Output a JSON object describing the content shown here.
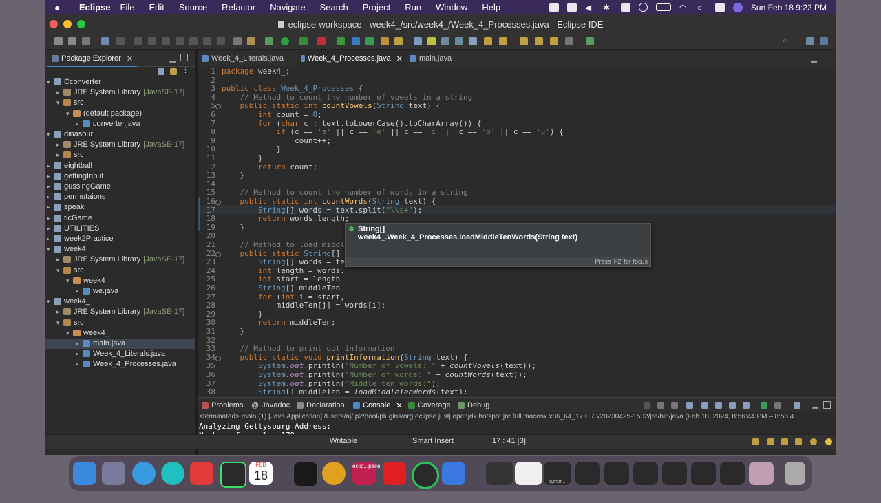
{
  "menubar": {
    "app": "Eclipse",
    "items": [
      "File",
      "Edit",
      "Source",
      "Refactor",
      "Navigate",
      "Search",
      "Project",
      "Run",
      "Window",
      "Help"
    ],
    "clock": "Sun Feb 18  9:22 PM"
  },
  "window": {
    "title": "eclipse-workspace - week4_/src/week4_/Week_4_Processes.java - Eclipse IDE"
  },
  "package_explorer": {
    "title": "Package Explorer",
    "tree": [
      {
        "label": "Cconverter",
        "suffix": "",
        "icon": "project-icon",
        "depth": 0,
        "twisty": "v"
      },
      {
        "label": "JRE System Library",
        "suffix": "[JavaSE-17]",
        "icon": "library-icon",
        "depth": 1,
        "twisty": ">"
      },
      {
        "label": "src",
        "suffix": "",
        "icon": "folder-icon",
        "depth": 1,
        "twisty": "v"
      },
      {
        "label": "(default package)",
        "suffix": "",
        "icon": "package-icon",
        "depth": 2,
        "twisty": "v"
      },
      {
        "label": "converter.java",
        "suffix": "",
        "icon": "java-file-icon",
        "depth": 3,
        "twisty": ">"
      },
      {
        "label": "dinasour",
        "suffix": "",
        "icon": "project-icon",
        "depth": 0,
        "twisty": "v"
      },
      {
        "label": "JRE System Library",
        "suffix": "[JavaSE-17]",
        "icon": "library-icon",
        "depth": 1,
        "twisty": ">"
      },
      {
        "label": "src",
        "suffix": "",
        "icon": "folder-icon",
        "depth": 1,
        "twisty": ">"
      },
      {
        "label": "eightball",
        "suffix": "",
        "icon": "project-icon",
        "depth": 0,
        "twisty": ">"
      },
      {
        "label": "gettingInput",
        "suffix": "",
        "icon": "project-icon",
        "depth": 0,
        "twisty": ">"
      },
      {
        "label": "gussingGame",
        "suffix": "",
        "icon": "project-icon",
        "depth": 0,
        "twisty": ">"
      },
      {
        "label": "permutaions",
        "suffix": "",
        "icon": "project-icon",
        "depth": 0,
        "twisty": ">"
      },
      {
        "label": "speak",
        "suffix": "",
        "icon": "project-icon",
        "depth": 0,
        "twisty": ">"
      },
      {
        "label": "ticGame",
        "suffix": "",
        "icon": "project-icon",
        "depth": 0,
        "twisty": ">"
      },
      {
        "label": "UTILITIES",
        "suffix": "",
        "icon": "project-icon",
        "depth": 0,
        "twisty": ">"
      },
      {
        "label": "week2Practice",
        "suffix": "",
        "icon": "project-icon",
        "depth": 0,
        "twisty": ">"
      },
      {
        "label": "week4",
        "suffix": "",
        "icon": "project-icon",
        "depth": 0,
        "twisty": "v"
      },
      {
        "label": "JRE System Library",
        "suffix": "[JavaSE-17]",
        "icon": "library-icon",
        "depth": 1,
        "twisty": ">"
      },
      {
        "label": "src",
        "suffix": "",
        "icon": "folder-icon",
        "depth": 1,
        "twisty": "v"
      },
      {
        "label": "week4",
        "suffix": "",
        "icon": "package-icon",
        "depth": 2,
        "twisty": "v"
      },
      {
        "label": "we.java",
        "suffix": "",
        "icon": "java-file-icon",
        "depth": 3,
        "twisty": ">"
      },
      {
        "label": "week4_",
        "suffix": "",
        "icon": "project-icon",
        "depth": 0,
        "twisty": "v"
      },
      {
        "label": "JRE System Library",
        "suffix": "[JavaSE-17]",
        "icon": "library-icon",
        "depth": 1,
        "twisty": ">"
      },
      {
        "label": "src",
        "suffix": "",
        "icon": "folder-icon",
        "depth": 1,
        "twisty": "v"
      },
      {
        "label": "week4_",
        "suffix": "",
        "icon": "package-icon",
        "depth": 2,
        "twisty": "v"
      },
      {
        "label": "main.java",
        "suffix": "",
        "icon": "java-file-icon",
        "depth": 3,
        "twisty": ">",
        "selected": true
      },
      {
        "label": "Week_4_Literals.java",
        "suffix": "",
        "icon": "java-file-icon",
        "depth": 3,
        "twisty": ">"
      },
      {
        "label": "Week_4_Processes.java",
        "suffix": "",
        "icon": "java-file-icon",
        "depth": 3,
        "twisty": ">"
      }
    ]
  },
  "editor": {
    "tabs": [
      {
        "label": "Week_4_Literals.java",
        "active": false
      },
      {
        "label": "Week_4_Processes.java",
        "active": true
      },
      {
        "label": "main.java",
        "active": false
      }
    ],
    "lines": [
      {
        "n": "1",
        "code": "<span class=\"kw\">package</span> week4_;"
      },
      {
        "n": "2",
        "code": ""
      },
      {
        "n": "3",
        "code": "<span class=\"kw\">public class</span> <span class=\"ty\">Week_4_Processes</span> {"
      },
      {
        "n": "4",
        "code": "    <span class=\"cm\">// Method to count the number of vowels in a string</span>"
      },
      {
        "n": "5",
        "code": "    <span class=\"kw\">public static int</span> <span class=\"mt\">countVowels</span>(<span class=\"ty\">String</span> text) {"
      },
      {
        "n": "6",
        "code": "        <span class=\"kw\">int</span> count = <span class=\"ty\">0</span>;"
      },
      {
        "n": "7",
        "code": "        <span class=\"kw\">for</span> (<span class=\"kw\">char</span> c : text.toLowerCase().toCharArray()) {"
      },
      {
        "n": "8",
        "code": "            <span class=\"kw\">if</span> (c == <span class=\"st\">'a'</span> || c == <span class=\"st\">'e'</span> || c == <span class=\"st\">'i'</span> || c == <span class=\"st\">'o'</span> || c == <span class=\"st\">'u'</span>) {"
      },
      {
        "n": "9",
        "code": "                count++;"
      },
      {
        "n": "10",
        "code": "            }"
      },
      {
        "n": "11",
        "code": "        }"
      },
      {
        "n": "12",
        "code": "        <span class=\"kw\">return</span> count;"
      },
      {
        "n": "13",
        "code": "    }"
      },
      {
        "n": "14",
        "code": ""
      },
      {
        "n": "15",
        "code": "    <span class=\"cm\">// Method to count the number of words in a string</span>"
      },
      {
        "n": "16",
        "code": "    <span class=\"kw\">public static int</span> <span class=\"mt\">countWords</span>(<span class=\"ty\">String</span> text) {"
      },
      {
        "n": "17",
        "code": "        <span class=\"ty\">String</span>[] words = text.split(<span class=\"st\">\"\\\\s+\"</span>);"
      },
      {
        "n": "18",
        "code": "        <span class=\"kw\">return</span> words.length;"
      },
      {
        "n": "19",
        "code": "    }"
      },
      {
        "n": "20",
        "code": ""
      },
      {
        "n": "21",
        "code": "    <span class=\"cm\">// Method to load middle ten words into an array</span>"
      },
      {
        "n": "22",
        "code": "    <span class=\"kw\">public static</span> <span class=\"ty\">String</span>[] <span class=\"mt\">loadMiddleTenWords</span>(<span class=\"ty\">String</span> text) {"
      },
      {
        "n": "23",
        "code": "        <span class=\"ty\">String</span>[] words = te"
      },
      {
        "n": "24",
        "code": "        <span class=\"kw\">int</span> length = words."
      },
      {
        "n": "25",
        "code": "        <span class=\"kw\">int</span> start = length"
      },
      {
        "n": "26",
        "code": "        <span class=\"ty\">String</span>[] middleTen"
      },
      {
        "n": "27",
        "code": "        <span class=\"kw\">for</span> (<span class=\"kw\">int</span> i = start,"
      },
      {
        "n": "28",
        "code": "            middleTen[j] = words[i];"
      },
      {
        "n": "29",
        "code": "        }"
      },
      {
        "n": "30",
        "code": "        <span class=\"kw\">return</span> middleTen;"
      },
      {
        "n": "31",
        "code": "    }"
      },
      {
        "n": "32",
        "code": ""
      },
      {
        "n": "33",
        "code": "    <span class=\"cm\">// Method to print out information</span>"
      },
      {
        "n": "34",
        "code": "    <span class=\"kw\">public static void</span> <span class=\"mt\">printInformation</span>(<span class=\"ty\">String</span> text) {"
      },
      {
        "n": "35",
        "code": "        <span class=\"ty\">System</span>.<span class=\"fd\"><b><i>out</i></b></span>.println(<span class=\"st\">\"Number of vowels: \"</span> + <i>countVowels</i>(text));"
      },
      {
        "n": "36",
        "code": "        <span class=\"ty\">System</span>.<span class=\"fd\"><b><i>out</i></b></span>.println(<span class=\"st\">\"Number of words: \"</span> + <i>countWords</i>(text));"
      },
      {
        "n": "37",
        "code": "        <span class=\"ty\">System</span>.<span class=\"fd\"><b><i>out</i></b></span>.println(<span class=\"st\">\"Middle ten words:\"</span>);"
      },
      {
        "n": "38",
        "code": "        <span class=\"ty\">String</span>[] middleTen = <i>loadMiddleTenWords</i>(text);"
      }
    ],
    "tooltip": {
      "line1": "String[]",
      "line2": "week4_.Week_4_Processes.loadMiddleTenWords(String text)",
      "footer": "Press 'F2' for focus"
    }
  },
  "bottom_panel": {
    "tabs": [
      "Problems",
      "Javadoc",
      "Declaration",
      "Console",
      "Coverage",
      "Debug"
    ],
    "active_tab": "Console",
    "terminated": "<terminated> main (1) [Java Application] /Users/aj/.p2/pool/plugins/org.eclipse.justj.openjdk.hotspot.jre.full.macosx.x86_64_17.0.7.v20230425-1502/jre/bin/java  (Feb 18, 2024, 8:56:44 PM – 8:56:4",
    "output": [
      "Analyzing Gettysburg Address:",
      "Number of vowels: 179"
    ]
  },
  "status": {
    "writable": "Writable",
    "insert_mode": "Smart Insert",
    "position": "17 : 41 [3]"
  },
  "dock": {
    "calendar_month": "FEB",
    "calendar_day": "18",
    "eclipse_label": "eclip...pace",
    "python_label": "python..."
  }
}
